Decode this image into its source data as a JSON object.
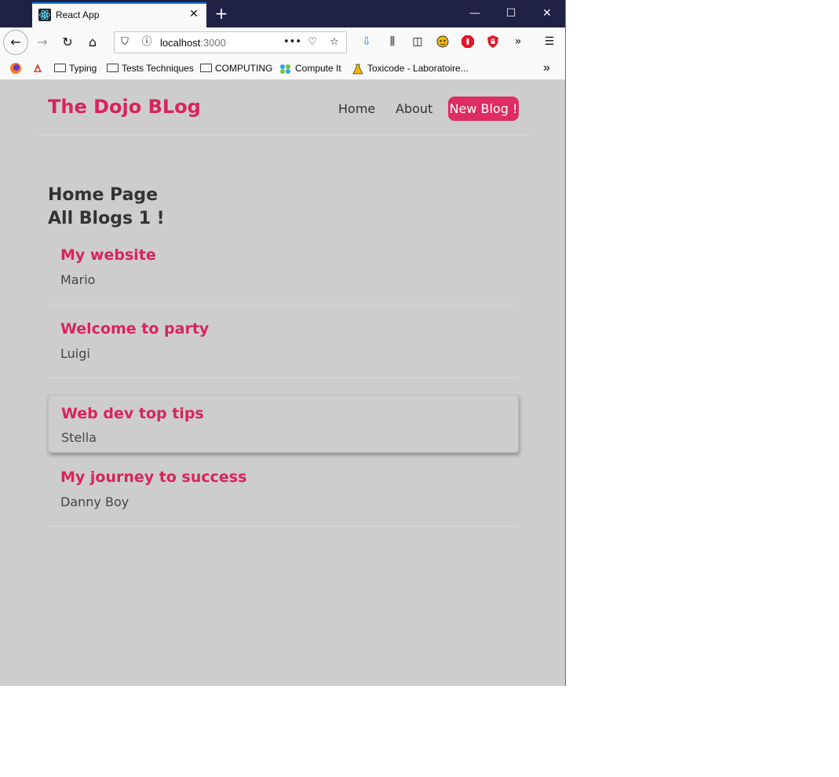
{
  "browser": {
    "tab_title": "React App",
    "url_host": "localhost",
    "url_port": ":3000",
    "bookmarks": [
      "Typing",
      "Tests Techniques",
      "COMPUTING",
      "Compute It",
      "Toxicode - Laboratoire..."
    ]
  },
  "site": {
    "title": "The Dojo BLog",
    "nav": {
      "home": "Home",
      "about": "About",
      "new_blog": "New Blog !"
    }
  },
  "main": {
    "heading": "Home Page",
    "subheading": "All Blogs 1 !",
    "blogs": [
      {
        "title": "My website",
        "author": "Mario"
      },
      {
        "title": "Welcome to party",
        "author": "Luigi"
      },
      {
        "title": "Web dev top tips",
        "author": "Stella"
      },
      {
        "title": "My journey to success",
        "author": "Danny Boy"
      }
    ]
  },
  "colors": {
    "accent": "#d8245c",
    "button": "#dd2d62",
    "page_bg": "#cdcdcd",
    "titlebar": "#1f2245"
  }
}
